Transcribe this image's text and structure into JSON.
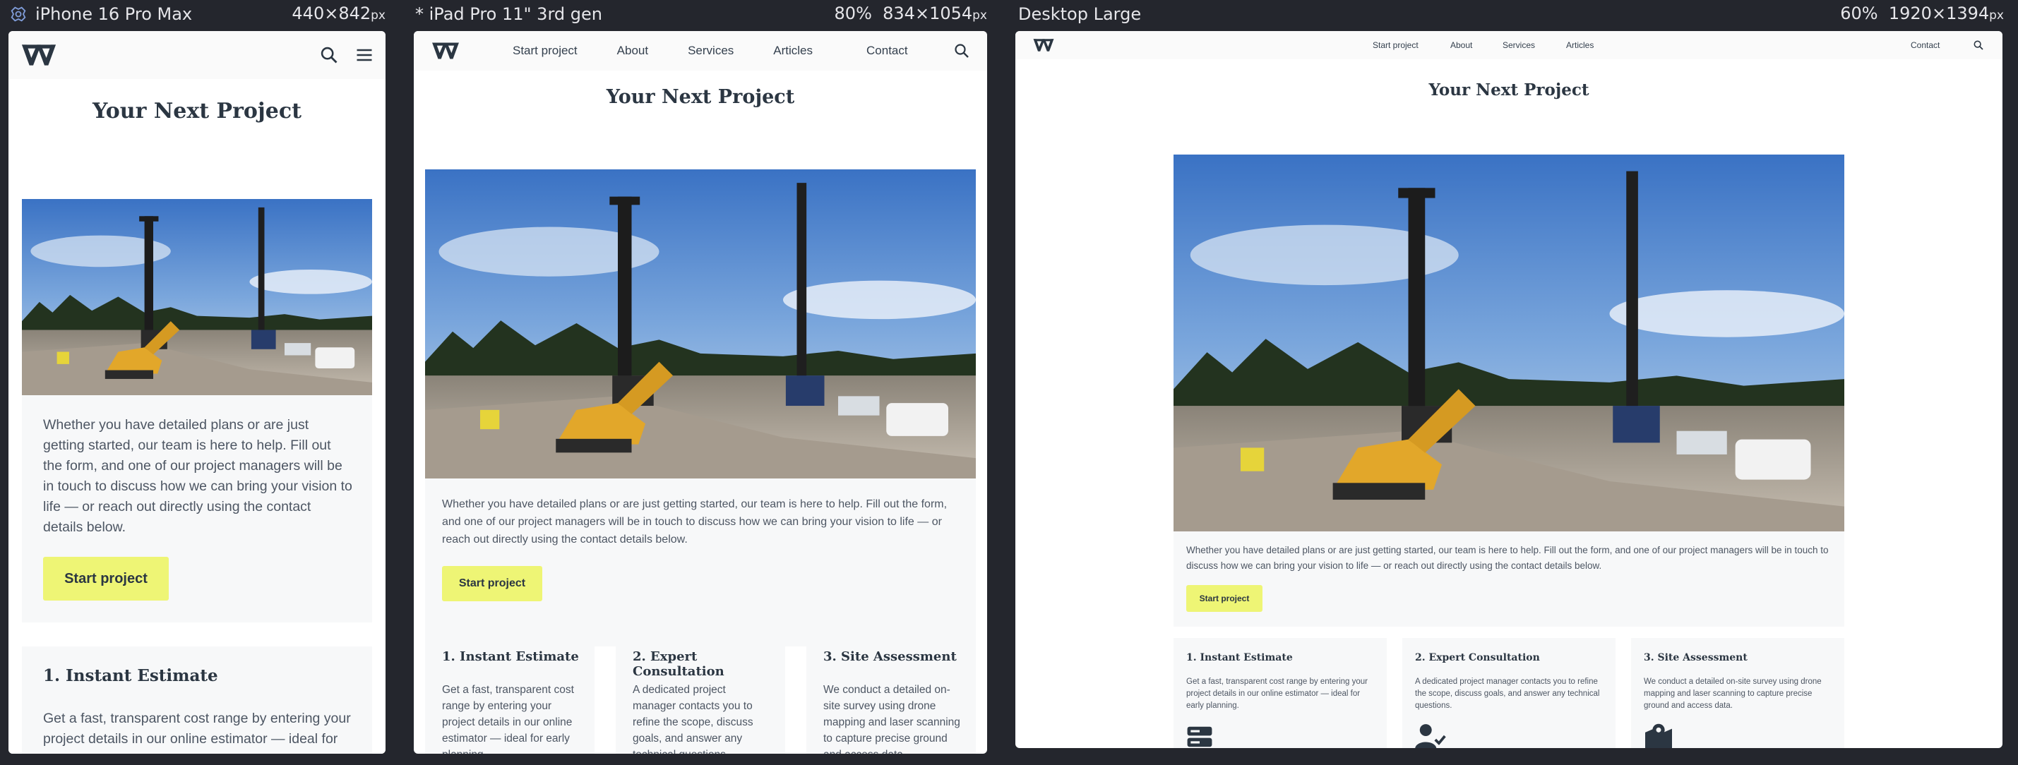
{
  "devices": [
    {
      "name": "iPhone 16 Pro Max",
      "zoom": "",
      "width": "440",
      "height": "842",
      "unit": "px"
    },
    {
      "name": "* iPad Pro 11\" 3rd gen",
      "zoom": "80%",
      "width": "834",
      "height": "1054",
      "unit": "px"
    },
    {
      "name": "Desktop Large",
      "zoom": "60%",
      "width": "1920",
      "height": "1394",
      "unit": "px"
    }
  ],
  "dims_sep": "×",
  "nav": {
    "start_project": "Start project",
    "about": "About",
    "services": "Services",
    "articles": "Articles",
    "contact": "Contact"
  },
  "page": {
    "title": "Your Next Project",
    "intro": "Whether you have detailed plans or are just getting started, our team is here to help. Fill out the form, and one of our project managers will be in touch to discuss how we can bring your vision to life — or reach out directly using the contact details below.",
    "cta": "Start project"
  },
  "steps": [
    {
      "title": "1. Instant Estimate",
      "text": "Get a fast, transparent cost range by entering your project details in our online estimator — ideal for early planning."
    },
    {
      "title": "2. Expert Consultation",
      "text": "A dedicated project manager contacts you to refine the scope, discuss goals, and answer any technical questions."
    },
    {
      "title": "3. Site Assessment",
      "text": "We conduct a detailed on-site survey using drone mapping and laser scanning to capture precise ground and access data."
    }
  ],
  "colors": {
    "background": "#24262d",
    "accent": "#eef575",
    "heading": "#2b3642"
  },
  "icons": [
    "settings-icon",
    "search-icon",
    "hamburger-menu-icon",
    "logo-icon",
    "server-icon",
    "user-check-icon",
    "map-pin-icon"
  ]
}
